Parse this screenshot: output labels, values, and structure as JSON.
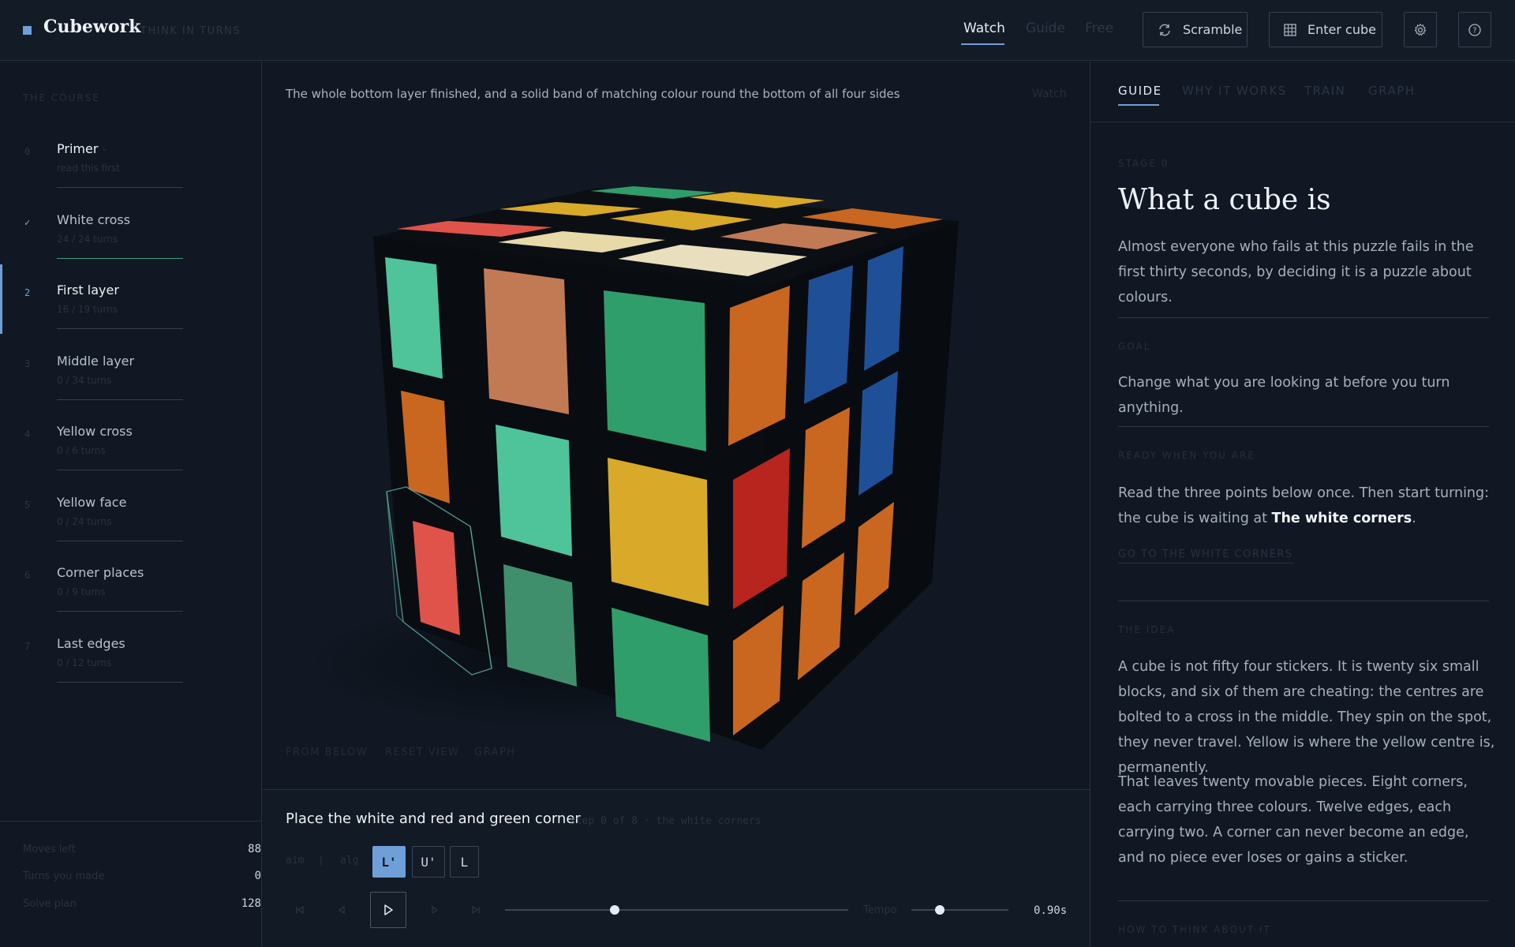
{
  "app": {
    "name": "Cubework",
    "tagline": "THINK IN TURNS",
    "modes": [
      "Watch",
      "Guide",
      "Free"
    ],
    "active_mode": "Watch",
    "scramble_label": "Scramble",
    "enter_cube_label": "Enter cube",
    "accent": "#6e9fd8"
  },
  "sidebar": {
    "heading": "THE COURSE",
    "stages": [
      {
        "num": "0",
        "title": "Primer",
        "sub": "read this first"
      },
      {
        "num": "✓",
        "title": "White cross",
        "sub": "24 / 24 turns"
      },
      {
        "num": "2",
        "title": "First layer",
        "sub": "16 / 19 turns"
      },
      {
        "num": "3",
        "title": "Middle layer",
        "sub": "0 / 34 turns"
      },
      {
        "num": "4",
        "title": "Yellow cross",
        "sub": "0 / 6 turns"
      },
      {
        "num": "5",
        "title": "Yellow face",
        "sub": "0 / 24 turns"
      },
      {
        "num": "6",
        "title": "Corner places",
        "sub": "0 / 9 turns"
      },
      {
        "num": "7",
        "title": "Last edges",
        "sub": "0 / 12 turns"
      }
    ],
    "active_stage": 2,
    "stats": [
      {
        "label": "Moves left",
        "value": "88"
      },
      {
        "label": "Turns you made",
        "value": "0"
      },
      {
        "label": "Solve plan",
        "value": "128"
      }
    ]
  },
  "viewer": {
    "caption": "The whole bottom layer finished, and a solid band of matching colour round the bottom of all four sides",
    "mode_label": "Watch",
    "links": [
      "FROM BELOW",
      "RESET VIEW",
      "GRAPH"
    ]
  },
  "player": {
    "step_title": "Place the white and red and green corner",
    "step_meta": "step 0 of 8 · the white corners",
    "aim_label": "aim",
    "aim_sep": "|",
    "aim_alg": "alg",
    "moves": [
      "L'",
      "U'",
      "L"
    ],
    "current_move": 0,
    "progress": 0.32,
    "tempo_label": "Tempo",
    "tempo_fraction": 0.29,
    "tempo_value": "0.90s"
  },
  "guide": {
    "tabs": [
      "GUIDE",
      "WHY IT WORKS",
      "TRAIN",
      "GRAPH"
    ],
    "active_tab": 0,
    "stage_kicker": "STAGE 0",
    "title": "What a cube is",
    "intro": "Almost everyone who fails at this puzzle fails in the first thirty seconds, by deciding it is a puzzle about colours.",
    "goal_kicker": "GOAL",
    "goal": "Change what you are looking at before you turn anything.",
    "ready_kicker": "READY WHEN YOU ARE",
    "ready_text_before": "Read the three points below once. Then start turning: the cube is waiting at ",
    "ready_strong": "The white corners",
    "ready_text_after": ".",
    "ready_link": "GO TO THE WHITE CORNERS",
    "idea_kicker": "THE IDEA",
    "idea_p1": "A cube is not fifty four stickers. It is twenty six small blocks, and six of them are cheating: the centres are bolted to a cross in the middle. They spin on the spot, they never travel. Yellow is where the yellow centre is, permanently.",
    "idea_p2": "That leaves twenty movable pieces. Eight corners, each carrying three colours. Twelve edges, each carrying two. A corner can never become an edge, and no piece ever loses or gains a sticker.",
    "think_kicker": "HOW TO THINK ABOUT IT"
  },
  "cube_colors": {
    "green": "#2f9e6a",
    "mint": "#4fc39a",
    "orange": "#c9661f",
    "salmon": "#c27a55",
    "blue": "#1f4f97",
    "red": "#b8241e",
    "yellow": "#d9a929",
    "coral": "#e0534a"
  }
}
